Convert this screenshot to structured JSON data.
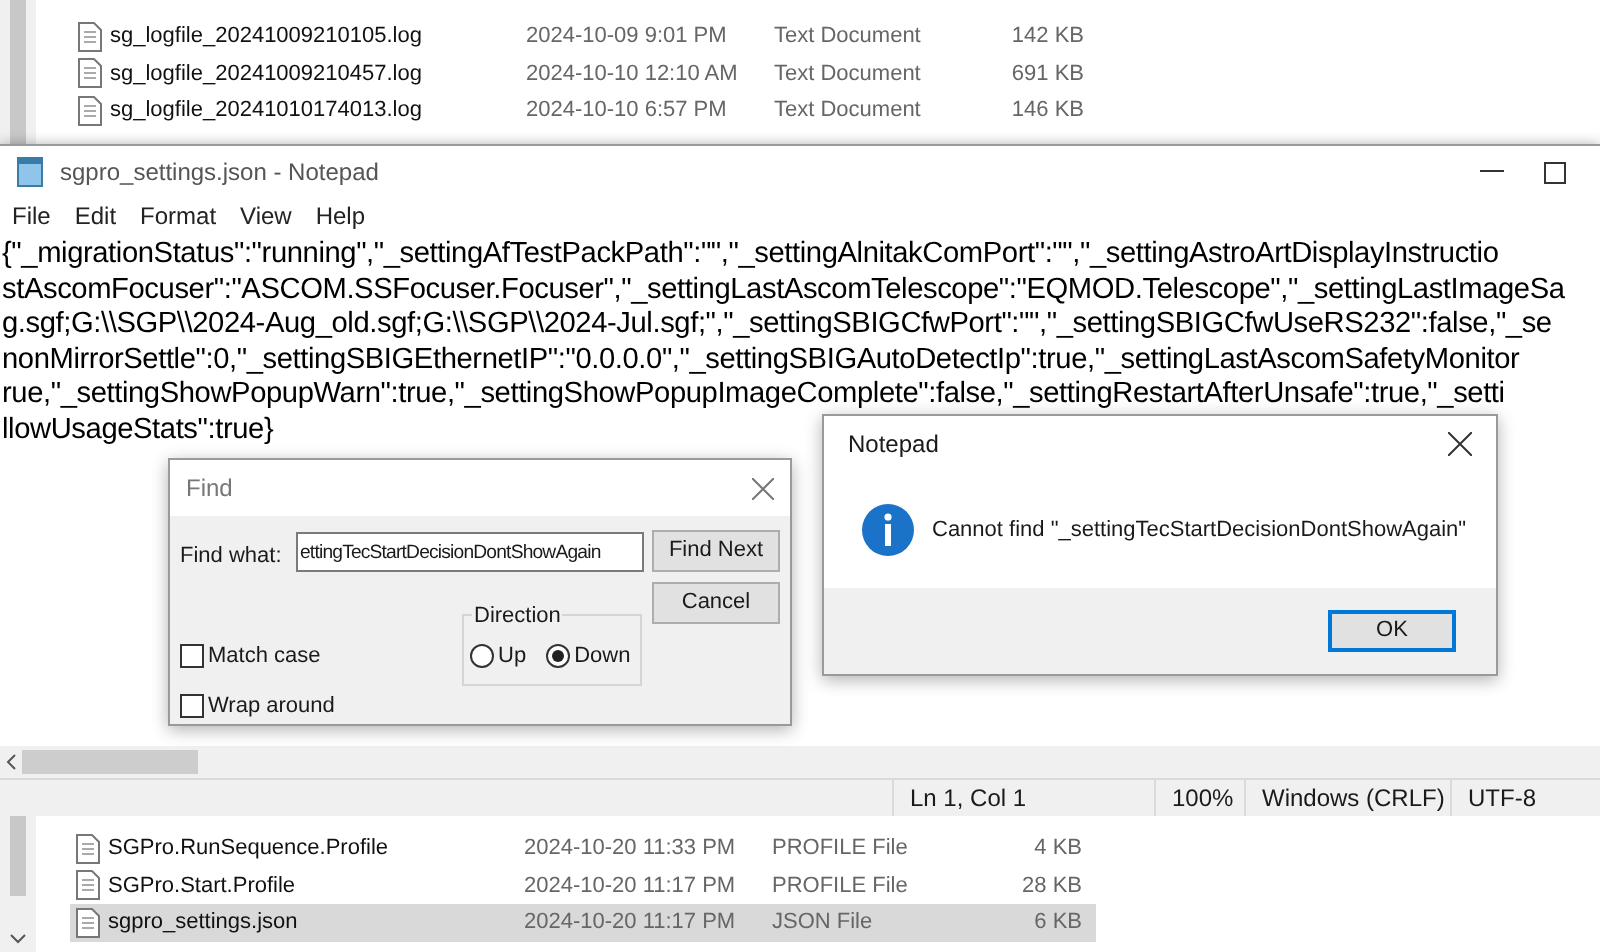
{
  "explorer_top": {
    "rows": [
      {
        "name": "sg_logfile_20241009210105.log",
        "date": "2024-10-09 9:01 PM",
        "type": "Text Document",
        "size": "142 KB",
        "selected": false
      },
      {
        "name": "sg_logfile_20241009210457.log",
        "date": "2024-10-10 12:10 AM",
        "type": "Text Document",
        "size": "691 KB",
        "selected": false
      },
      {
        "name": "sg_logfile_20241010174013.log",
        "date": "2024-10-10 6:57 PM",
        "type": "Text Document",
        "size": "146 KB",
        "selected": false
      }
    ]
  },
  "notepad": {
    "title": "sgpro_settings.json - Notepad",
    "menu": [
      "File",
      "Edit",
      "Format",
      "View",
      "Help"
    ],
    "lines": [
      "{\"_migrationStatus\":\"running\",\"_settingAfTestPackPath\":\"\",\"_settingAlnitakComPort\":\"\",\"_settingAstroArtDisplayInstructio",
      "stAscomFocuser\":\"ASCOM.SSFocuser.Focuser\",\"_settingLastAscomTelescope\":\"EQMOD.Telescope\",\"_settingLastImageSa",
      "g.sgf;G:\\\\SGP\\\\2024-Aug_old.sgf;G:\\\\SGP\\\\2024-Jul.sgf;\",\"_settingSBIGCfwPort\":\"\",\"_settingSBIGCfwUseRS232\":false,\"_se",
      "nonMirrorSettle\":0,\"_settingSBIGEthernetIP\":\"0.0.0.0\",\"_settingSBIGAutoDetectIp\":true,\"_settingLastAscomSafetyMonitor",
      "rue,\"_settingShowPopupWarn\":true,\"_settingShowPopupImageComplete\":false,\"_settingRestartAfterUnsafe\":true,\"_setti",
      "llowUsageStats\":true}"
    ],
    "status_bar": [
      "Ln 1, Col 1",
      "100%",
      "Windows (CRLF)",
      "UTF-8"
    ]
  },
  "explorer_bottom": {
    "rows": [
      {
        "name": "SGPro.RunSequence.Profile",
        "date": "2024-10-20 11:33 PM",
        "type": "PROFILE File",
        "size": "4 KB",
        "selected": false
      },
      {
        "name": "SGPro.Start.Profile",
        "date": "2024-10-20 11:17 PM",
        "type": "PROFILE File",
        "size": "28 KB",
        "selected": false
      },
      {
        "name": "sgpro_settings.json",
        "date": "2024-10-20 11:17 PM",
        "type": "JSON File",
        "size": "6 KB",
        "selected": true
      }
    ]
  },
  "find_dialog": {
    "title": "Find",
    "find_what_label": "Find what:",
    "find_what_value": "ettingTecStartDecisionDontShowAgain",
    "buttons": [
      "Find Next",
      "Cancel"
    ],
    "direction": {
      "label": "Direction",
      "options": [
        {
          "label": "Up",
          "selected": false
        },
        {
          "label": "Down",
          "selected": true
        }
      ]
    },
    "options": [
      {
        "label": "Match case",
        "checked": false
      },
      {
        "label": "Wrap around",
        "checked": false
      }
    ]
  },
  "message_box": {
    "title": "Notepad",
    "message": "Cannot find \"_settingTecStartDecisionDontShowAgain\"",
    "buttons": [
      "OK"
    ]
  }
}
